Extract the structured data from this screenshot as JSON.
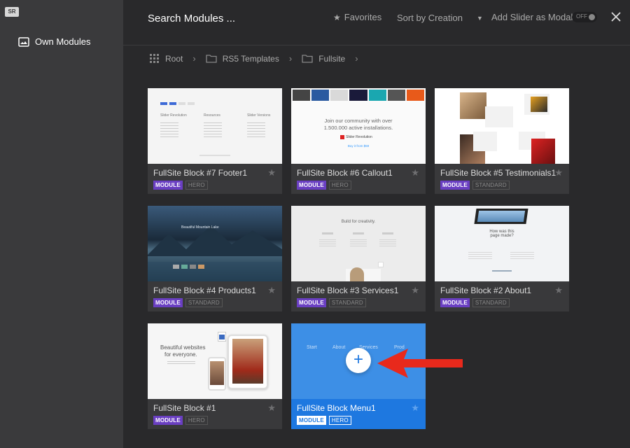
{
  "sidebar": {
    "logo": "SR",
    "items": [
      {
        "label": "Own Modules",
        "icon": "image-frame-icon"
      }
    ]
  },
  "header": {
    "search_placeholder": "Search Modules ...",
    "favorites_label": "Favorites",
    "sort_label": "Sort by Creation",
    "modal_label": "Add Slider as Modal",
    "toggle_state": "OFF"
  },
  "breadcrumb": [
    {
      "label": "Root",
      "icon": "grid-icon"
    },
    {
      "label": "RS5 Templates",
      "icon": "folder-icon"
    },
    {
      "label": "Fullsite",
      "icon": "folder-icon"
    }
  ],
  "modules": [
    {
      "title": "FullSite Block #7 Footer1",
      "tags": [
        "MODULE",
        "HERO"
      ]
    },
    {
      "title": "FullSite Block #6 Callout1",
      "tags": [
        "MODULE",
        "HERO"
      ]
    },
    {
      "title": "FullSite Block #5 Testimonials1",
      "tags": [
        "MODULE",
        "STANDARD"
      ]
    },
    {
      "title": "FullSite Block #4 Products1",
      "tags": [
        "MODULE",
        "STANDARD"
      ]
    },
    {
      "title": "FullSite Block #3 Services1",
      "tags": [
        "MODULE",
        "STANDARD"
      ]
    },
    {
      "title": "FullSite Block #2 About1",
      "tags": [
        "MODULE",
        "STANDARD"
      ]
    },
    {
      "title": "FullSite Block #1",
      "tags": [
        "MODULE",
        "HERO"
      ]
    },
    {
      "title": "FullSite Block Menu1",
      "tags": [
        "MODULE",
        "HERO"
      ]
    }
  ],
  "thumbnails": {
    "footer": {
      "brand": "Slider Revolution",
      "col2": "Resources",
      "col3": "Slider Versions"
    },
    "callout": {
      "line1": "Join our community with over",
      "line2": "1.500.000 active installations.",
      "brand": "Slider Revolution",
      "link": "Buy it from $59"
    },
    "products": {
      "heading": "Beautiful Mountain Lake"
    },
    "services": {
      "heading": "Build for creativity."
    },
    "about": {
      "heading": "How was this page made?"
    },
    "block1": {
      "line1": "Beautiful websites",
      "line2": "for everyone."
    },
    "menu": {
      "items": [
        "Start",
        "About",
        "Services",
        "Prod"
      ]
    }
  },
  "colors": {
    "accent_blue": "#1e78e0",
    "module_tag": "#6a3fc2",
    "arrow_red": "#e8291c"
  }
}
